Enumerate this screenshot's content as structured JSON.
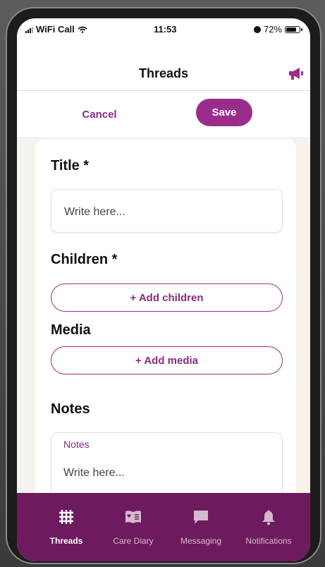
{
  "status_bar": {
    "carrier": "WiFi Call",
    "time": "11:53",
    "battery": "72%",
    "battery_level": 0.72
  },
  "header": {
    "title": "Threads",
    "right_icon": "megaphone-icon"
  },
  "actions": {
    "cancel": "Cancel",
    "save": "Save"
  },
  "form": {
    "title_label": "Title *",
    "title_placeholder": "Write here...",
    "children_label": "Children *",
    "add_children": "+ Add children",
    "media_label": "Media",
    "add_media": "+ Add media",
    "notes_label": "Notes",
    "notes_field_label": "Notes",
    "notes_placeholder": "Write here..."
  },
  "tabs": [
    {
      "label": "Threads",
      "icon": "grid-hash-icon",
      "active": true
    },
    {
      "label": "Care Diary",
      "icon": "diary-icon",
      "active": false
    },
    {
      "label": "Messaging",
      "icon": "chat-bubble-icon",
      "active": false
    },
    {
      "label": "Notifications",
      "icon": "bell-icon",
      "active": false
    }
  ],
  "colors": {
    "brand": "#9b2d8a",
    "tab_bar": "#6e1a5e"
  }
}
